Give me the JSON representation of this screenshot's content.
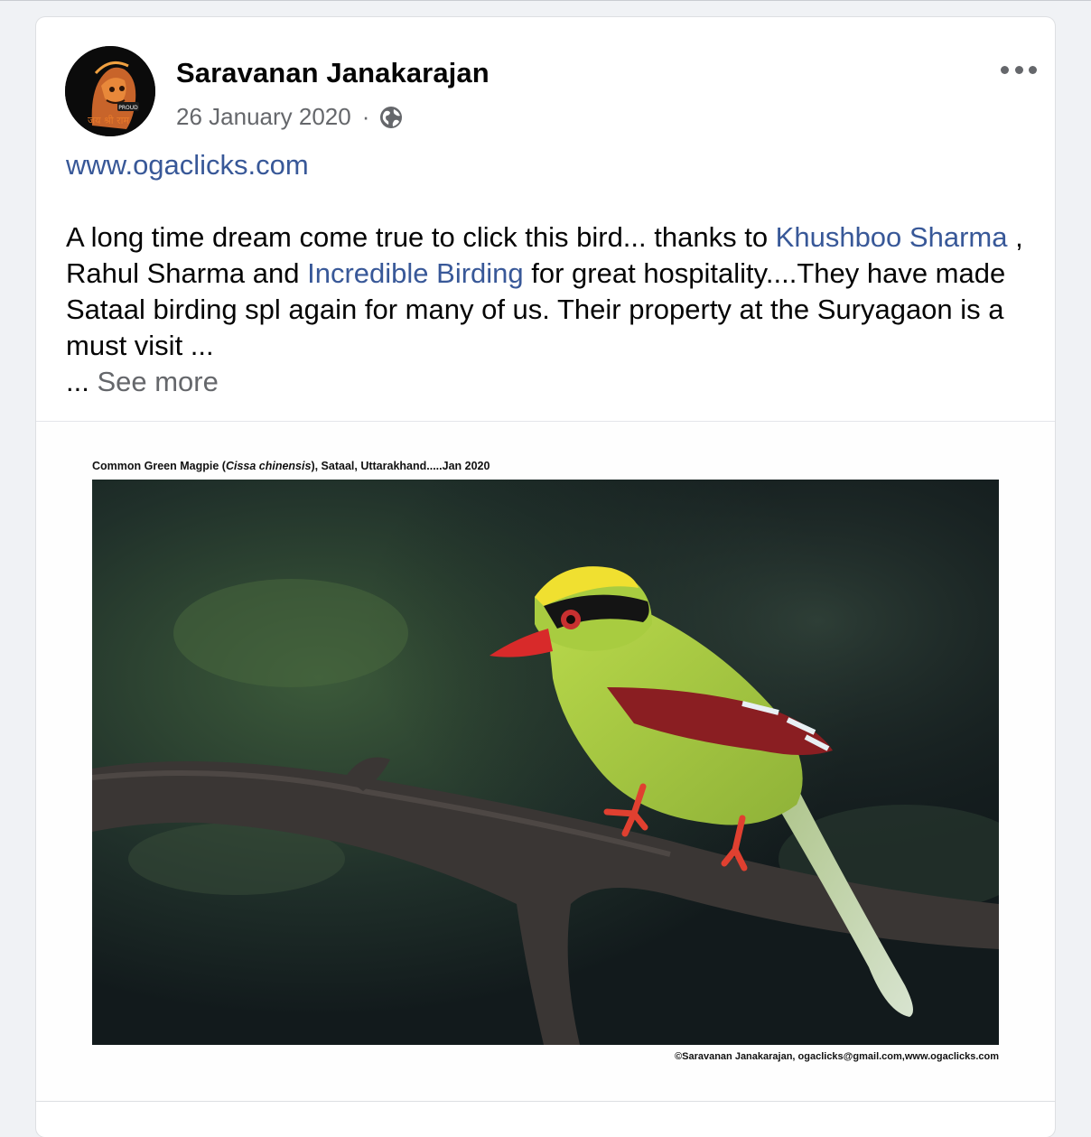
{
  "post": {
    "author": "Saravanan Janakarajan",
    "date": "26 January 2020",
    "separator": "·",
    "privacy_icon": "globe-icon",
    "link_text": "www.ogaclicks.com",
    "text": {
      "part1": "A long time dream come true to click this bird... thanks to ",
      "tag1": "Khushboo Sharma",
      "part2": " , Rahul Sharma and ",
      "tag2": "Incredible Birding",
      "part3": " for great hospitality....They have made Sataal birding spl again for many of us. Their property at the Suryagaon is a must visit ...",
      "ellipsis": "... ",
      "see_more": "See more"
    },
    "photo": {
      "caption_prefix": "Common Green Magpie (",
      "caption_italic": "Cissa chinensis",
      "caption_suffix": "), Sataal, Uttarakhand.....Jan 2020",
      "credit": "©Saravanan Janakarajan, ogaclicks@gmail.com,www.ogaclicks.com"
    },
    "avatar_text": "जय श्री राम",
    "avatar_badge": "PROUD"
  },
  "colors": {
    "link": "#385898",
    "secondary_text": "#65676b",
    "background": "#f0f2f5"
  }
}
